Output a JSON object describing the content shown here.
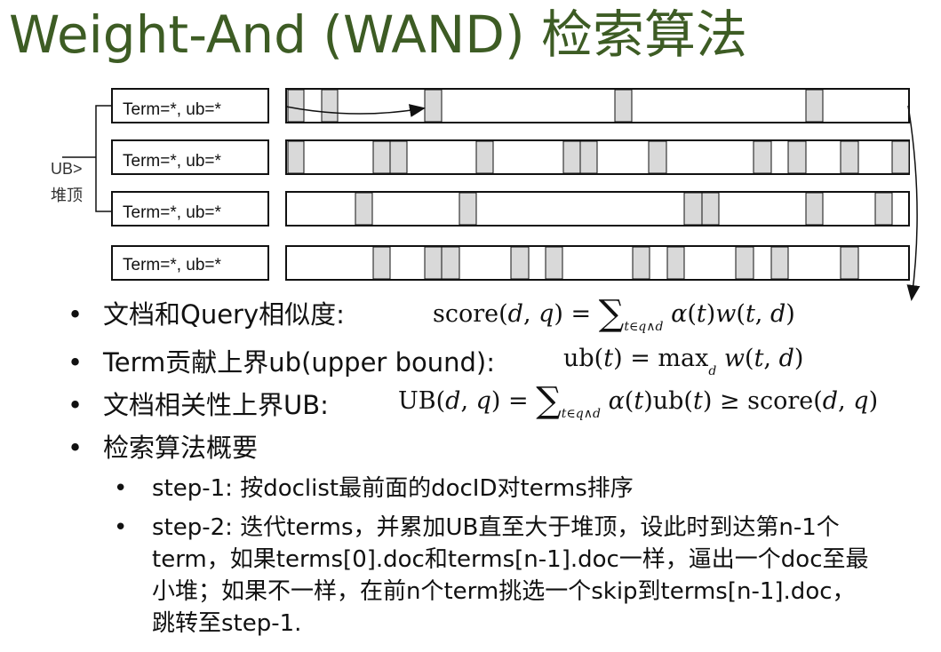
{
  "title": "Weight-And (WAND) 检索算法",
  "term_boxes": [
    "Term=*, ub=*",
    "Term=*, ub=*",
    "Term=*, ub=*",
    "Term=*, ub=*"
  ],
  "heap_label": {
    "line1": "UB>",
    "line2": "堆顶"
  },
  "bullets": [
    {
      "text": "文档和Query相似度:",
      "formula": "score(d, q) = ∑ t∈q∧d α(t) w(t, d)"
    },
    {
      "text": "Term贡献上界ub(upper bound):",
      "formula": "ub(t) = max d w(t, d)"
    },
    {
      "text": "文档相关性上界UB:",
      "formula": "UB(d, q) = ∑ t∈q∧d α(t) ub(t) ≥ score(d, q)"
    },
    {
      "text": "检索算法概要"
    }
  ],
  "sub_bullets": [
    "step-1: 按doclist最前面的docID对terms排序",
    "step-2: 迭代terms，并累加UB直至大于堆顶，设此时到达第n-1个term，如果terms[0].doc和terms[n-1].doc一样，逼出一个doc至最小堆；如果不一样，在前n个term挑选一个skip到terms[n-1].doc，跳转至step-1."
  ],
  "bullet_glyph": "•"
}
